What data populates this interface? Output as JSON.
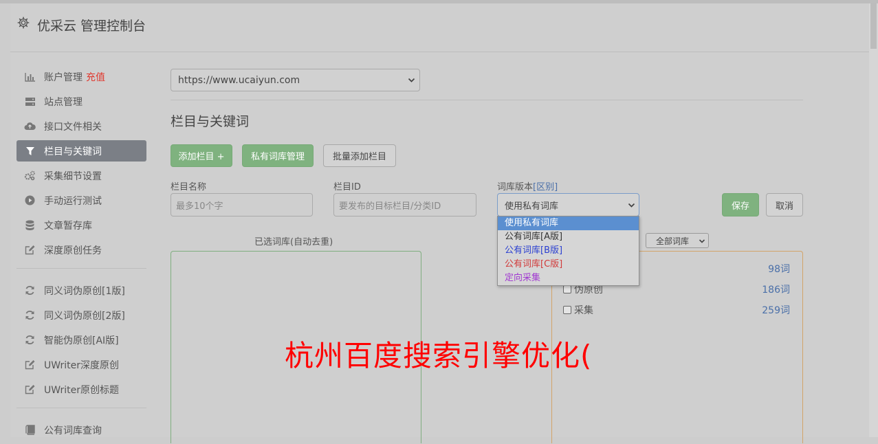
{
  "header": {
    "title": "优采云 管理控制台",
    "icon": "gear-icon"
  },
  "sidebar": {
    "group1": [
      {
        "label": "账户管理",
        "extra": "充值",
        "icon": "bar-chart-icon"
      },
      {
        "label": "站点管理",
        "icon": "server-icon"
      },
      {
        "label": "接口文件相关",
        "icon": "cloud-upload-icon"
      },
      {
        "label": "栏目与关键词",
        "icon": "filter-icon",
        "active": true
      },
      {
        "label": "采集细节设置",
        "icon": "gears-icon"
      },
      {
        "label": "手动运行测试",
        "icon": "play-circle-icon"
      },
      {
        "label": "文章暂存库",
        "icon": "database-icon"
      },
      {
        "label": "深度原创任务",
        "icon": "edit-icon"
      }
    ],
    "group2": [
      {
        "label": "同义词伪原创[1版]",
        "icon": "refresh-icon"
      },
      {
        "label": "同义词伪原创[2版]",
        "icon": "refresh-icon"
      },
      {
        "label": "智能伪原创[AI版]",
        "icon": "refresh-icon"
      },
      {
        "label": "UWriter深度原创",
        "icon": "edit-icon"
      },
      {
        "label": "UWriter原创标题",
        "icon": "edit-icon"
      }
    ],
    "group3": [
      {
        "label": "公有词库查询",
        "icon": "book-icon"
      }
    ]
  },
  "main": {
    "site_select": "https://www.ucaiyun.com",
    "section_title": "栏目与关键词",
    "buttons": {
      "add_column": "添加栏目 +",
      "private_lib": "私有词库管理",
      "batch_add": "批量添加栏目",
      "save": "保存",
      "cancel": "取消"
    },
    "fields": {
      "name_label": "栏目名称",
      "name_placeholder": "最多10个字",
      "id_label": "栏目ID",
      "id_placeholder": "要发布的目标栏目/分类ID",
      "lib_label": "词库版本",
      "lib_link": "[区别]",
      "lib_value": "使用私有词库"
    },
    "dropdown_options": [
      {
        "label": "使用私有词库",
        "color": "#ffffff"
      },
      {
        "label": "公有词库[A版]",
        "color": "#333333"
      },
      {
        "label": "公有词库[B版]",
        "color": "#2a3fd1"
      },
      {
        "label": "公有词库[C版]",
        "color": "#d13a3a"
      },
      {
        "label": "定向采集",
        "color": "#a13ad1"
      }
    ],
    "selected_panel_label": "已选词库(自动去重)",
    "lib_filter": "全部词库",
    "lib_list": [
      {
        "label": "",
        "count": "98词"
      },
      {
        "label": "伪原创",
        "count": "186词"
      },
      {
        "label": "采集",
        "count": "259词"
      }
    ]
  },
  "watermark": "杭州百度搜索引擎优化("
}
